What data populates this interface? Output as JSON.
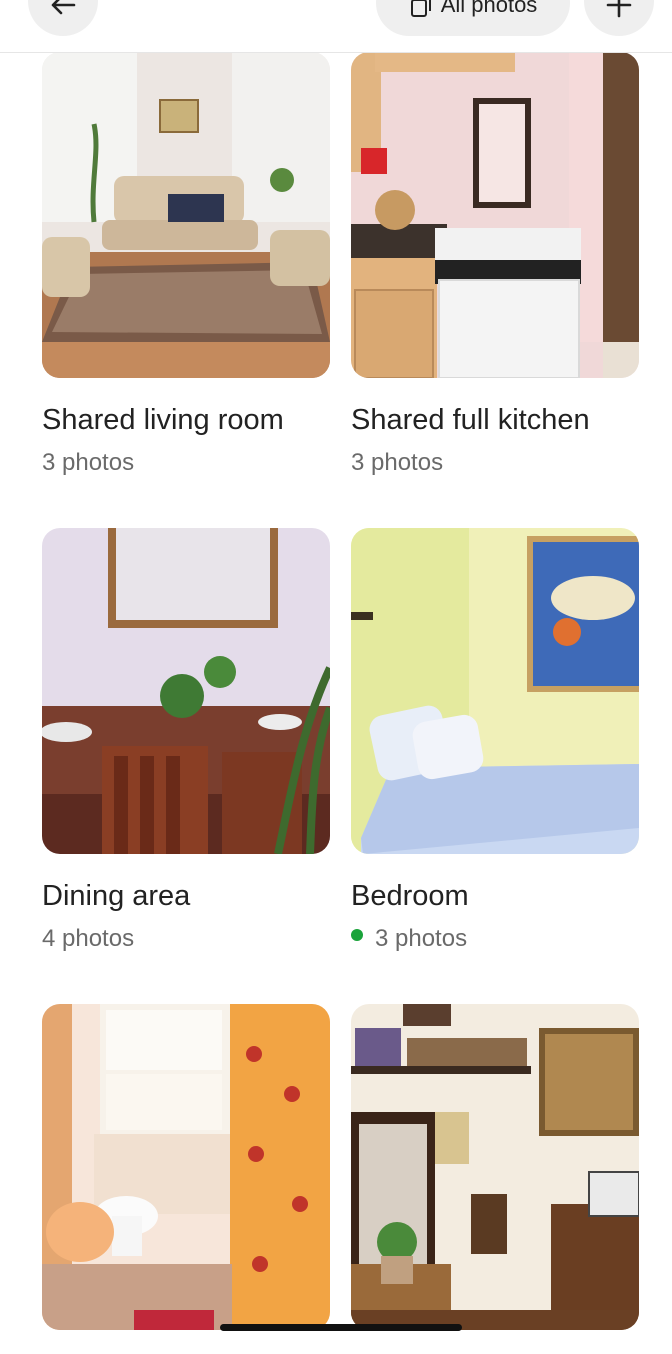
{
  "header": {
    "all_photos_label": "All photos"
  },
  "cards": [
    {
      "title": "Shared living room",
      "count": "3 photos"
    },
    {
      "title": "Shared full kitchen",
      "count": "3 photos"
    },
    {
      "title": "Dining area",
      "count": "4 photos"
    },
    {
      "title": "Bedroom",
      "count": "3 photos"
    },
    {
      "title": "",
      "count": ""
    },
    {
      "title": "",
      "count": ""
    }
  ],
  "colors": {
    "new_indicator": "#1aa33a",
    "button_bg": "#efefef"
  },
  "icons": {
    "back": "arrow-left-icon",
    "all_photos": "photo-stack-icon",
    "add": "plus-icon"
  }
}
